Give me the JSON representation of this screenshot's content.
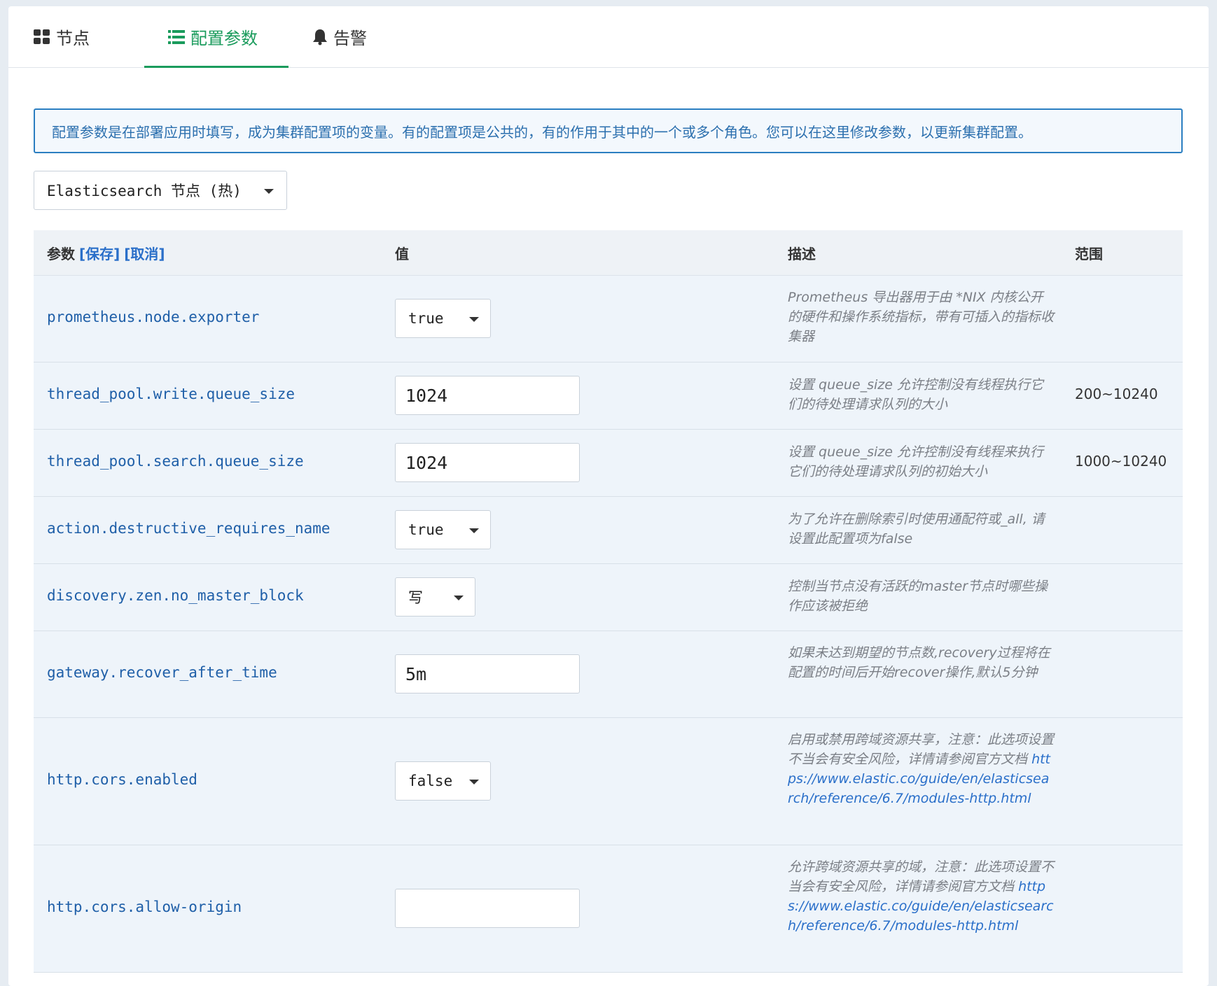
{
  "tabs": [
    {
      "label": "节点",
      "icon": "grid-icon",
      "active": false
    },
    {
      "label": "配置参数",
      "icon": "list-icon",
      "active": true
    },
    {
      "label": "告警",
      "icon": "bell-icon",
      "active": false
    }
  ],
  "alert": {
    "text": "配置参数是在部署应用时填写，成为集群配置项的变量。有的配置项是公共的，有的作用于其中的一个或多个角色。您可以在这里修改参数，以更新集群配置。"
  },
  "role_select": {
    "value": "Elasticsearch 节点 (热)"
  },
  "table": {
    "headers": {
      "param": "参数",
      "save": "[保存]",
      "cancel": "[取消]",
      "value": "值",
      "desc": "描述",
      "range": "范围"
    },
    "rows": [
      {
        "param": "prometheus.node.exporter",
        "value": "true",
        "control": "select",
        "desc": "Prometheus 导出器用于由 *NIX 内核公开的硬件和操作系统指标，带有可插入的指标收集器",
        "range": ""
      },
      {
        "param": "thread_pool.write.queue_size",
        "value": "1024",
        "control": "input",
        "desc": "设置 queue_size 允许控制没有线程执行它们的待处理请求队列的大小",
        "range": "200~10240"
      },
      {
        "param": "thread_pool.search.queue_size",
        "value": "1024",
        "control": "input",
        "desc": "设置 queue_size 允许控制没有线程来执行它们的待处理请求队列的初始大小",
        "range": "1000~10240"
      },
      {
        "param": "action.destructive_requires_name",
        "value": "true",
        "control": "select",
        "desc": "为了允许在删除索引时使用通配符或_all, 请设置此配置项为false",
        "range": ""
      },
      {
        "param": "discovery.zen.no_master_block",
        "value": "写",
        "control": "select",
        "desc": "控制当节点没有活跃的master节点时哪些操作应该被拒绝",
        "range": ""
      },
      {
        "param": "gateway.recover_after_time",
        "value": "5m",
        "control": "input",
        "desc": "如果未达到期望的节点数,recovery过程将在配置的时间后开始recover操作,默认5分钟",
        "range": ""
      },
      {
        "param": "http.cors.enabled",
        "value": "false",
        "control": "select",
        "desc": "启用或禁用跨域资源共享，注意：此选项设置不当会有安全风险，详情请参阅官方文档",
        "link": "https://www.elastic.co/guide/en/elasticsearch/reference/6.7/modules-http.html",
        "range": ""
      },
      {
        "param": "http.cors.allow-origin",
        "value": "",
        "control": "input",
        "desc": "允许跨域资源共享的域，注意：此选项设置不当会有安全风险，详情请参阅官方文档",
        "link": "https://www.elastic.co/guide/en/elasticsearch/reference/6.7/modules-http.html",
        "range": ""
      }
    ]
  }
}
